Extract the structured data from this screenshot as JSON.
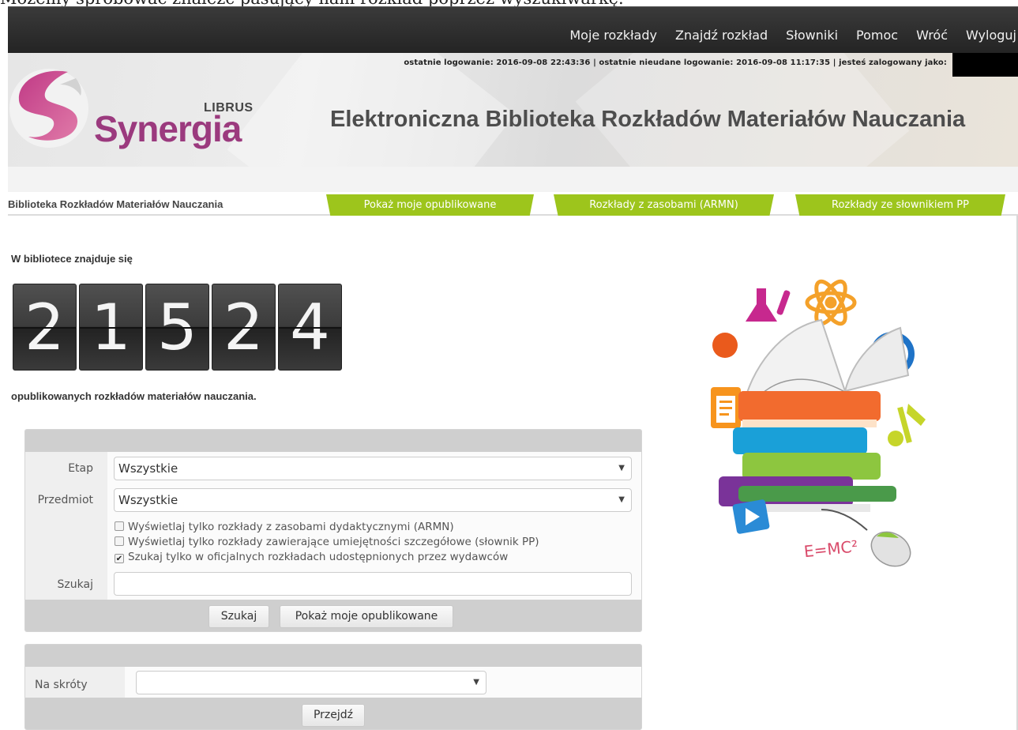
{
  "caption": "Możemy spróbować znaleźć pasujący nam rozkład poprzez wyszukiwarkę.",
  "topnav": {
    "items": [
      "Moje rozkłady",
      "Znajdź rozkład",
      "Słowniki",
      "Pomoc",
      "Wróć",
      "Wyloguj"
    ]
  },
  "header": {
    "login_info": "ostatnie logowanie: 2016-09-08 22:43:36   |   ostatnie nieudane logowanie: 2016-09-08 11:17:35   |   jesteś zalogowany jako:",
    "logo_brand": "LIBRUS",
    "logo_name": "Synergia",
    "app_title": "Elektroniczna Biblioteka Rozkładów Materiałów Nauczania"
  },
  "subnav": {
    "title": "Biblioteka Rozkładów Materiałów Nauczania",
    "tabs": [
      "Pokaż moje opublikowane",
      "Rozkłady z zasobami (ARMN)",
      "Rozkłady ze słownikiem PP"
    ]
  },
  "library": {
    "intro": "W bibliotece znajduje się",
    "digits": [
      "2",
      "1",
      "5",
      "2",
      "4"
    ],
    "outro": "opublikowanych rozkładów materiałów nauczania."
  },
  "search": {
    "etap_label": "Etap",
    "etap_value": "Wszystkie",
    "przedmiot_label": "Przedmiot",
    "przedmiot_value": "Wszystkie",
    "checks": [
      {
        "label": "Wyświetlaj tylko rozkłady z zasobami dydaktycznymi (ARMN)",
        "checked": false
      },
      {
        "label": "Wyświetlaj tylko rozkłady zawierające umiejętności szczegółowe (słownik PP)",
        "checked": false
      },
      {
        "label": "Szukaj tylko w oficjalnych rozkładach udostępnionych przez wydawców",
        "checked": true
      }
    ],
    "szukaj_label": "Szukaj",
    "szukaj_value": "",
    "search_button": "Szukaj",
    "show_mine_button": "Pokaż moje opublikowane"
  },
  "shortcuts": {
    "label": "Na skróty",
    "value": "",
    "go_button": "Przejdź"
  },
  "illustration": {
    "formula": "E=MC²"
  }
}
